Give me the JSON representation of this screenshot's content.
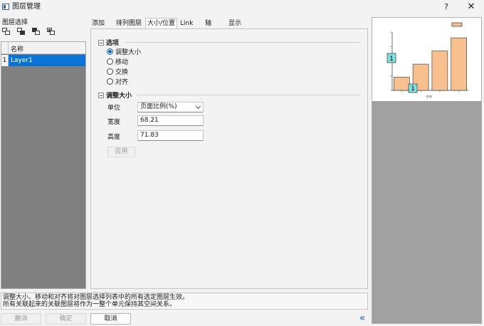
{
  "window": {
    "title": "图层管理",
    "help": "?",
    "close": "✕"
  },
  "layer_select": {
    "label": "图层选择",
    "column_header": "名称",
    "rows": [
      {
        "num": "1",
        "name": "Layer1"
      }
    ]
  },
  "tabs": [
    {
      "label": "添加"
    },
    {
      "label": "排列图层"
    },
    {
      "label": "大小/位置",
      "active": true
    },
    {
      "label": "Link"
    },
    {
      "label": "轴"
    },
    {
      "label": "显示"
    }
  ],
  "options": {
    "title": "选项",
    "radios": [
      "调整大小",
      "移动",
      "交换",
      "对齐"
    ],
    "selected": "调整大小"
  },
  "resize": {
    "title": "调整大小",
    "unit_label": "单位",
    "unit_value": "页面比例(%)",
    "width_label": "宽度",
    "width_value": "68.21",
    "height_label": "高度",
    "height_value": "71.83",
    "apply": "应用"
  },
  "preview": {
    "chart_data": {
      "type": "bar",
      "values": [
        18,
        36,
        54,
        72
      ],
      "layer_badges": [
        "1",
        "1"
      ],
      "bar_color": "#f9c08f",
      "xlabel": "抄本"
    }
  },
  "status": {
    "line1": "调整大小、移动和对齐将对图层选择列表中的所有选定图层生效。",
    "line2": "所有关联起来的关联图层将作为一整个单元保持其空间关系。"
  },
  "buttons": {
    "undo": "撤消",
    "ok": "确定",
    "cancel": "取消",
    "collapse": "«"
  },
  "colors": {
    "selection": "#0a73d6",
    "accent": "#1a5fb4",
    "teal_badge": "#7fe0e0"
  }
}
